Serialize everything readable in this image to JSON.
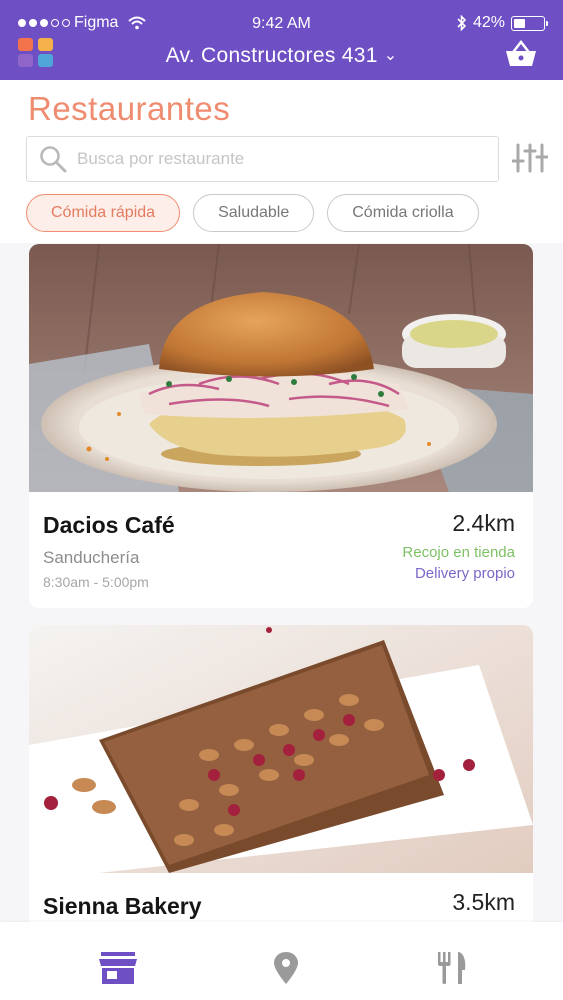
{
  "status_bar": {
    "carrier": "Figma",
    "time": "9:42 AM",
    "battery": "42%",
    "battery_level": 0.42
  },
  "header": {
    "address": "Av. Constructores 431",
    "logo_colors": [
      "#f3744c",
      "#f4b14a",
      "#9065c9",
      "#4fa6d8"
    ],
    "basket_icon": "basket-icon",
    "accent": "#6e4fc4"
  },
  "main": {
    "title": "Restaurantes",
    "search_placeholder": "Busca por restaurante",
    "chips": [
      {
        "label": "Cómida rápida",
        "active": true
      },
      {
        "label": "Saludable",
        "active": false
      },
      {
        "label": "Cómida criolla",
        "active": false
      }
    ]
  },
  "restaurants": [
    {
      "name": "Dacios Café",
      "category": "Sanduchería",
      "hours": "8:30am - 5:00pm",
      "distance": "2.4km",
      "pickup": "Recojo en tienda",
      "delivery": "Delivery propio",
      "photo": "sandwich-photo"
    },
    {
      "name": "Sienna Bakery",
      "distance": "3.5km",
      "photo": "nut-bread-photo"
    }
  ],
  "tabbar": {
    "items": [
      "store-icon",
      "location-pin-icon",
      "fork-knife-icon"
    ],
    "active_color": "#6e4fc4",
    "inactive_color": "#9a9a9a"
  }
}
